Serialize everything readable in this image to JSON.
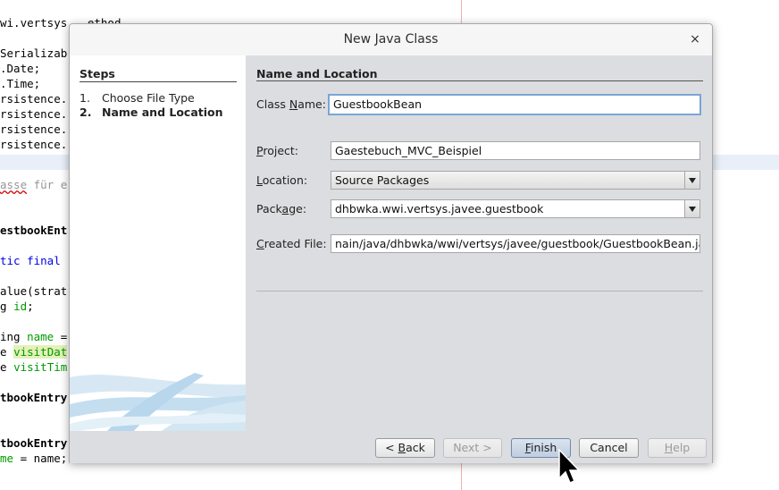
{
  "editor": {
    "lines": [
      {
        "segments": [
          {
            "t": "wi.vertsys"
          },
          {
            "t": "...",
            "c": "cmt"
          },
          {
            "t": "ethod"
          }
        ]
      },
      {
        "segments": [
          {
            "t": "Serializab"
          }
        ]
      },
      {
        "segments": [
          {
            "t": ".Date;"
          }
        ]
      },
      {
        "segments": [
          {
            "t": ".Time;"
          }
        ]
      },
      {
        "segments": [
          {
            "t": "rsistence."
          }
        ]
      },
      {
        "segments": [
          {
            "t": "rsistence."
          }
        ]
      },
      {
        "segments": [
          {
            "t": "rsistence."
          }
        ]
      },
      {
        "segments": [
          {
            "t": "rsistence."
          }
        ]
      },
      {
        "segments": [
          {
            "t": "asse",
            "c": "cmt squig"
          },
          {
            "t": " für e",
            "c": "cmt"
          }
        ]
      },
      {
        "segments": [
          {
            "t": "estbookEnt"
          }
        ]
      },
      {
        "segments": [
          {
            "t": "tic final",
            "c": "kw"
          }
        ]
      },
      {
        "segments": [
          {
            "t": "alue(strat"
          }
        ]
      },
      {
        "segments": [
          {
            "t": "g "
          },
          {
            "t": "id",
            "c": "fld"
          },
          {
            "t": ";"
          }
        ]
      },
      {
        "segments": [
          {
            "t": "ing "
          },
          {
            "t": "name",
            "c": "fld"
          },
          {
            "t": " ="
          }
        ]
      },
      {
        "segments": [
          {
            "t": "e "
          },
          {
            "t": "visitDat",
            "c": "fld hlbox"
          }
        ]
      },
      {
        "segments": [
          {
            "t": "e "
          },
          {
            "t": "visitTim",
            "c": "fld"
          }
        ]
      },
      {
        "segments": [
          {
            "t": "tbookEntry"
          }
        ]
      },
      {
        "segments": [
          {
            "t": "tbookEntry"
          }
        ]
      },
      {
        "segments": [
          {
            "t": "me",
            "c": "fld"
          },
          {
            "t": " = name;"
          }
        ]
      }
    ]
  },
  "dialog": {
    "title": "New Java Class",
    "close_glyph": "×",
    "steps": {
      "heading": "Steps",
      "items": [
        {
          "number": "1.",
          "label": "Choose File Type",
          "current": false
        },
        {
          "number": "2.",
          "label": "Name and Location",
          "current": true
        }
      ]
    },
    "section_title": "Name and Location",
    "class_name": {
      "label_pre": "Class ",
      "label_mn": "N",
      "label_post": "ame:",
      "value": "GuestbookBean"
    },
    "project": {
      "label_pre": "",
      "label_mn": "P",
      "label_post": "roject:",
      "value": "Gaestebuch_MVC_Beispiel"
    },
    "location": {
      "label_pre": "",
      "label_mn": "L",
      "label_post": "ocation:",
      "value": "Source Packages"
    },
    "package": {
      "label_pre": "Pack",
      "label_mn": "a",
      "label_post": "ge:",
      "value": "dhbwka.wwi.vertsys.javee.guestbook"
    },
    "created_file": {
      "label_pre": "",
      "label_mn": "C",
      "label_post": "reated File:",
      "value": "nain/java/dhbwka/wwi/vertsys/javee/guestbook/GuestbookBean.java"
    },
    "buttons": {
      "back": {
        "pre": "< ",
        "mn": "B",
        "post": "ack"
      },
      "next": {
        "pre": "Next >",
        "mn": "",
        "post": ""
      },
      "finish": {
        "pre": "",
        "mn": "F",
        "post": "inish"
      },
      "cancel": {
        "pre": "Cancel",
        "mn": "",
        "post": ""
      },
      "help": {
        "pre": "",
        "mn": "H",
        "post": "elp"
      }
    }
  },
  "colors": {
    "accent_focus": "#7aa5d6",
    "panel_bg": "#dcdde0"
  }
}
